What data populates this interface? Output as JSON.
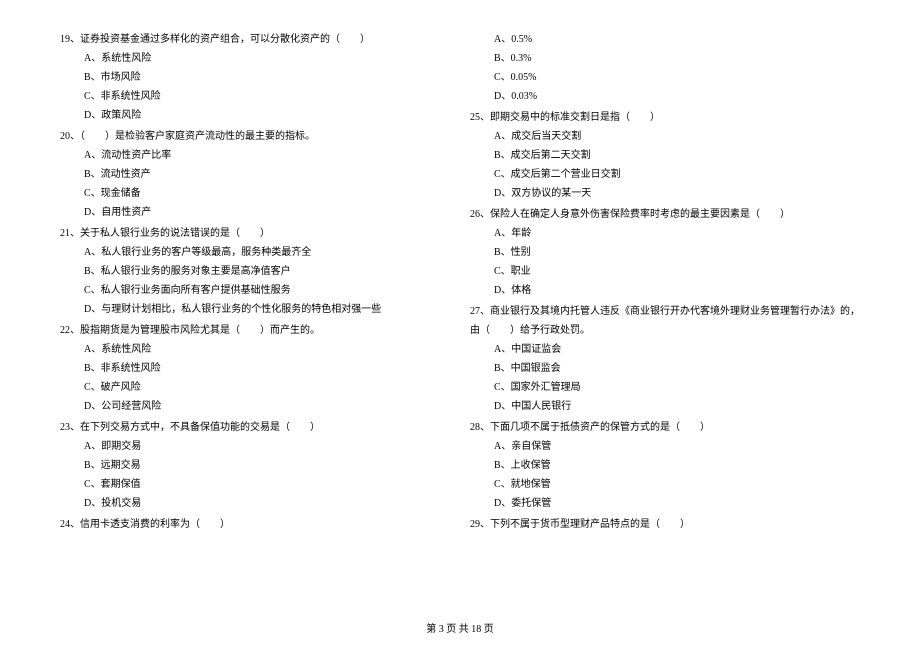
{
  "leftColumn": {
    "q19": {
      "text": "19、证券投资基金通过多样化的资产组合，可以分散化资产的（　　）",
      "optA": "A、系统性风险",
      "optB": "B、市场风险",
      "optC": "C、非系统性风险",
      "optD": "D、政策风险"
    },
    "q20": {
      "text": "20、（　　）是检验客户家庭资产流动性的最主要的指标。",
      "optA": "A、流动性资产比率",
      "optB": "B、流动性资产",
      "optC": "C、现金储备",
      "optD": "D、自用性资产"
    },
    "q21": {
      "text": "21、关于私人银行业务的说法错误的是（　　）",
      "optA": "A、私人银行业务的客户等级最高，服务种类最齐全",
      "optB": "B、私人银行业务的服务对象主要是高净值客户",
      "optC": "C、私人银行业务面向所有客户提供基础性服务",
      "optD": "D、与理财计划相比，私人银行业务的个性化服务的特色相对强一些"
    },
    "q22": {
      "text": "22、股指期货是为管理股市风险尤其是（　　）而产生的。",
      "optA": "A、系统性风险",
      "optB": "B、非系统性风险",
      "optC": "C、破产风险",
      "optD": "D、公司经营风险"
    },
    "q23": {
      "text": "23、在下列交易方式中，不具备保值功能的交易是（　　）",
      "optA": "A、即期交易",
      "optB": "B、远期交易",
      "optC": "C、套期保值",
      "optD": "D、投机交易"
    },
    "q24": {
      "text": "24、信用卡透支消费的利率为（　　）"
    }
  },
  "rightColumn": {
    "q24opts": {
      "optA": "A、0.5%",
      "optB": "B、0.3%",
      "optC": "C、0.05%",
      "optD": "D、0.03%"
    },
    "q25": {
      "text": "25、即期交易中的标准交割日是指（　　）",
      "optA": "A、成交后当天交割",
      "optB": "B、成交后第二天交割",
      "optC": "C、成交后第二个营业日交割",
      "optD": "D、双方协议的某一天"
    },
    "q26": {
      "text": "26、保险人在确定人身意外伤害保险费率时考虑的最主要因素是（　　）",
      "optA": "A、年龄",
      "optB": "B、性别",
      "optC": "C、职业",
      "optD": "D、体格"
    },
    "q27": {
      "text": "27、商业银行及其境内托管人违反《商业银行开办代客境外理财业务管理暂行办法》的，由（　　）给予行政处罚。",
      "optA": "A、中国证监会",
      "optB": "B、中国银监会",
      "optC": "C、国家外汇管理局",
      "optD": "D、中国人民银行"
    },
    "q28": {
      "text": "28、下面几项不属于抵债资产的保管方式的是（　　）",
      "optA": "A、亲自保管",
      "optB": "B、上收保管",
      "optC": "C、就地保管",
      "optD": "D、委托保管"
    },
    "q29": {
      "text": "29、下列不属于货币型理财产品特点的是（　　）"
    }
  },
  "footer": "第 3 页 共 18 页"
}
